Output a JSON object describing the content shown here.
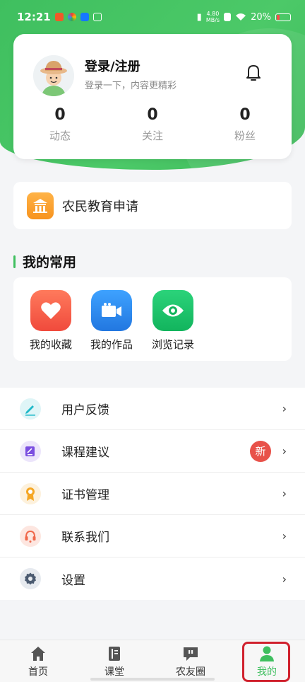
{
  "status_bar": {
    "time": "12:21",
    "net_speed_value": "4.80",
    "net_speed_unit": "MB/s",
    "battery": "20%"
  },
  "profile": {
    "title": "登录/注册",
    "subtitle": "登录一下，内容更精彩",
    "stats": [
      {
        "value": "0",
        "label": "动态"
      },
      {
        "value": "0",
        "label": "关注"
      },
      {
        "value": "0",
        "label": "粉丝"
      }
    ]
  },
  "education": {
    "label": "农民教育申请"
  },
  "common": {
    "heading": "我的常用",
    "items": [
      {
        "label": "我的收藏",
        "icon": "heart-icon",
        "color": "#f4574a"
      },
      {
        "label": "我的作品",
        "icon": "video-camera-icon",
        "color": "#2f86f0"
      },
      {
        "label": "浏览记录",
        "icon": "eye-icon",
        "color": "#1fbf6a"
      }
    ]
  },
  "menu": {
    "items": [
      {
        "label": "用户反馈",
        "icon": "pen-icon",
        "color": "#1fb9c9"
      },
      {
        "label": "课程建议",
        "icon": "note-edit-icon",
        "color": "#7a4ee0",
        "badge": "新"
      },
      {
        "label": "证书管理",
        "icon": "medal-icon",
        "color": "#f5a623"
      },
      {
        "label": "联系我们",
        "icon": "headset-icon",
        "color": "#f0674a"
      },
      {
        "label": "设置",
        "icon": "gear-icon",
        "color": "#4a5a70"
      }
    ],
    "chevron": "›"
  },
  "tabbar": {
    "tabs": [
      {
        "label": "首页",
        "icon": "home-icon"
      },
      {
        "label": "课堂",
        "icon": "book-icon"
      },
      {
        "label": "农友圈",
        "icon": "chat-quote-icon"
      },
      {
        "label": "我的",
        "icon": "user-icon",
        "active": true
      }
    ]
  },
  "colors": {
    "brand_green": "#3fbf5f",
    "badge_red": "#e8524a",
    "highlight_red": "#d0212d"
  }
}
